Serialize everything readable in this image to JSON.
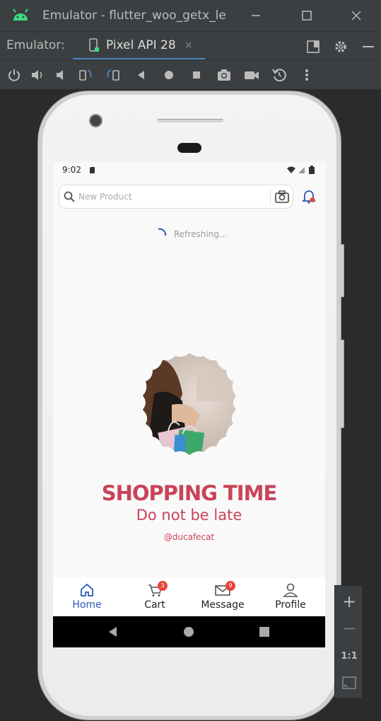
{
  "window": {
    "title": "Emulator - flutter_woo_getx_le",
    "minimize_icon": "minimize-icon",
    "maximize_icon": "maximize-icon",
    "close_icon": "close-icon"
  },
  "tabbar": {
    "label": "Emulator:",
    "tab_label": "Pixel API 28",
    "close_glyph": "×"
  },
  "toolbar": {
    "icons": [
      "power-icon",
      "volume-up-icon",
      "volume-down-icon",
      "rotate-left-icon",
      "rotate-right-icon",
      "back-icon",
      "home-icon",
      "overview-icon",
      "screenshot-icon",
      "record-icon",
      "snapshot-icon",
      "more-icon"
    ]
  },
  "phone": {
    "status_time": "9:02",
    "search_placeholder": "New Product",
    "refresh_text": "Refreshing...",
    "headline": "SHOPPING TIME",
    "subline": "Do not be late",
    "handle": "@ducafecat",
    "nav": [
      {
        "label": "Home",
        "icon": "home-icon",
        "active": true
      },
      {
        "label": "Cart",
        "icon": "cart-icon",
        "badge": "3"
      },
      {
        "label": "Message",
        "icon": "mail-icon",
        "badge": "9"
      },
      {
        "label": "Profile",
        "icon": "person-icon"
      }
    ]
  },
  "zoom": {
    "plus": "+",
    "minus": "−",
    "one_to_one": "1:1"
  },
  "colors": {
    "accent": "#c94458",
    "nav_active": "#2a5ab8",
    "badge": "#e8453c",
    "ide_bg": "#3c3f41"
  }
}
